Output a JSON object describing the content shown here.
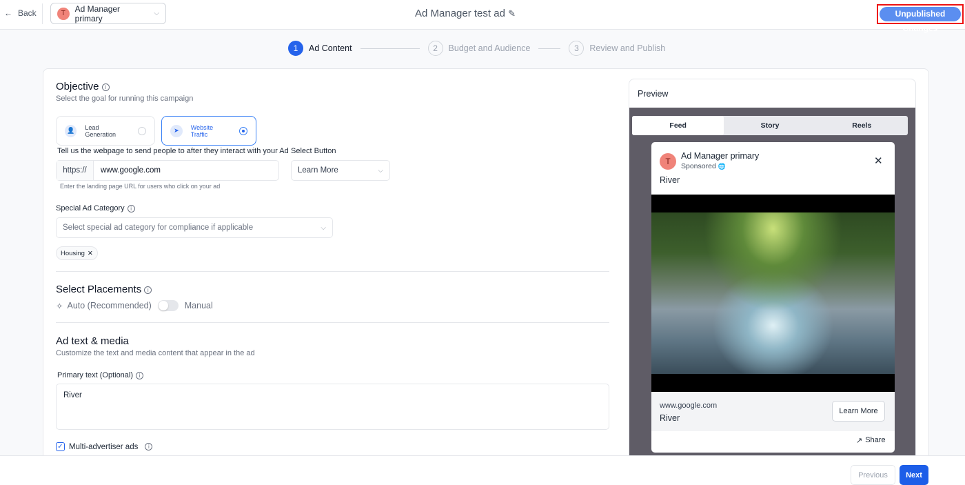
{
  "header": {
    "back": "Back",
    "account": "Ad Manager primary",
    "account_initial": "T",
    "title": "Ad Manager test ad",
    "unpublished": "Unpublished Changes"
  },
  "steps": [
    {
      "num": "1",
      "label": "Ad Content"
    },
    {
      "num": "2",
      "label": "Budget and Audience"
    },
    {
      "num": "3",
      "label": "Review and Publish"
    }
  ],
  "objective": {
    "title": "Objective",
    "subtitle": "Select the goal for running this campaign",
    "options": [
      {
        "label": "Lead Generation",
        "selected": false
      },
      {
        "label": "Website Traffic",
        "selected": true
      }
    ]
  },
  "url": {
    "label": "Tell us the webpage to send people to after they interact with your Ad",
    "prefix": "https://",
    "value": "www.google.com",
    "help": "Enter the landing page URL for users who click on your ad"
  },
  "select_button": {
    "label": "Select Button",
    "value": "Learn More"
  },
  "special": {
    "label": "Special Ad Category",
    "placeholder": "Select special ad category for compliance if applicable",
    "tags": [
      "Housing"
    ]
  },
  "placements": {
    "title": "Select Placements",
    "auto": "Auto (Recommended)",
    "manual": "Manual"
  },
  "media": {
    "title": "Ad text & media",
    "subtitle": "Customize the text and media content that appear in the ad",
    "primary_label": "Primary text (Optional)",
    "primary_value": "River",
    "multi": "Multi-advertiser ads",
    "multi_checked": true
  },
  "preview": {
    "title": "Preview",
    "tabs": [
      "Feed",
      "Story",
      "Reels"
    ],
    "account": "Ad Manager primary",
    "sponsored": "Sponsored",
    "text": "River",
    "domain": "www.google.com",
    "headline": "River",
    "cta": "Learn More",
    "share": "Share"
  },
  "footer": {
    "previous": "Previous",
    "next": "Next"
  }
}
